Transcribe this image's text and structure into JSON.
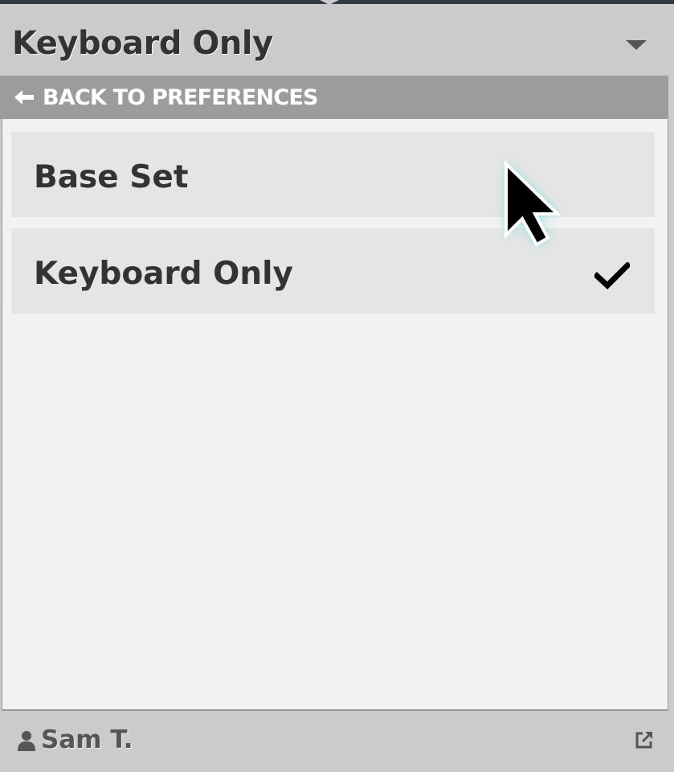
{
  "header": {
    "title": "Keyboard Only",
    "dropdown_icon": "chevron-down-icon"
  },
  "back_bar": {
    "icon": "arrow-left-icon",
    "label": "BACK TO PREFERENCES"
  },
  "options": [
    {
      "label": "Base Set",
      "selected": false
    },
    {
      "label": "Keyboard Only",
      "selected": true,
      "icon": "checkmark-icon"
    }
  ],
  "footer": {
    "user_icon": "user-icon",
    "user_name": "Sam T.",
    "popout_icon": "external-link-icon"
  },
  "colors": {
    "header_bg": "#cbcbcb",
    "back_bar_bg": "#9c9c9c",
    "panel_bg": "#f2f2f2",
    "option_bg": "#e5e5e5",
    "text": "#333333",
    "cursor_glow": "#5fd6d6"
  }
}
